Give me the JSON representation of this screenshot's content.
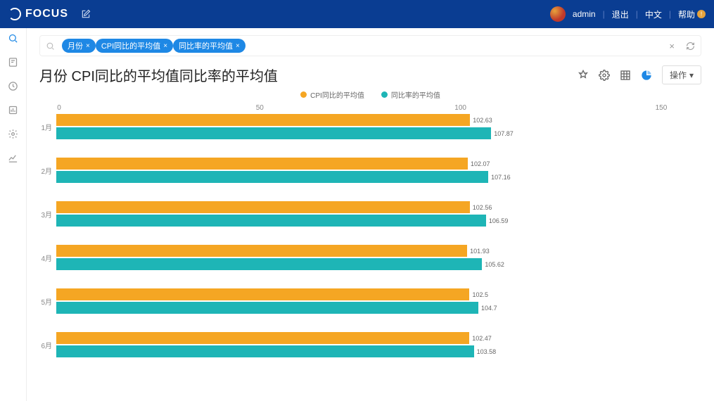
{
  "app_name": "FOCUS",
  "user": "admin",
  "top_links": {
    "logout": "退出",
    "lang": "中文",
    "help": "帮助"
  },
  "chips": [
    "月份",
    "CPI同比的平均值",
    "同比率的平均值"
  ],
  "title": "月份 CPI同比的平均值同比率的平均值",
  "op_button": "操作",
  "chart_data": {
    "type": "bar",
    "orientation": "horizontal",
    "categories": [
      "1月",
      "2月",
      "3月",
      "4月",
      "5月",
      "6月"
    ],
    "series": [
      {
        "name": "CPI同比的平均值",
        "color": "#f5a623",
        "values": [
          102.63,
          102.07,
          102.56,
          101.93,
          102.5,
          102.47
        ]
      },
      {
        "name": "同比率的平均值",
        "color": "#1eb5b6",
        "values": [
          107.87,
          107.16,
          106.59,
          105.62,
          104.7,
          103.58
        ]
      }
    ],
    "x_ticks": [
      0,
      50,
      100,
      150
    ],
    "xlim": [
      0,
      160
    ],
    "title": "",
    "xlabel": "",
    "ylabel": ""
  }
}
